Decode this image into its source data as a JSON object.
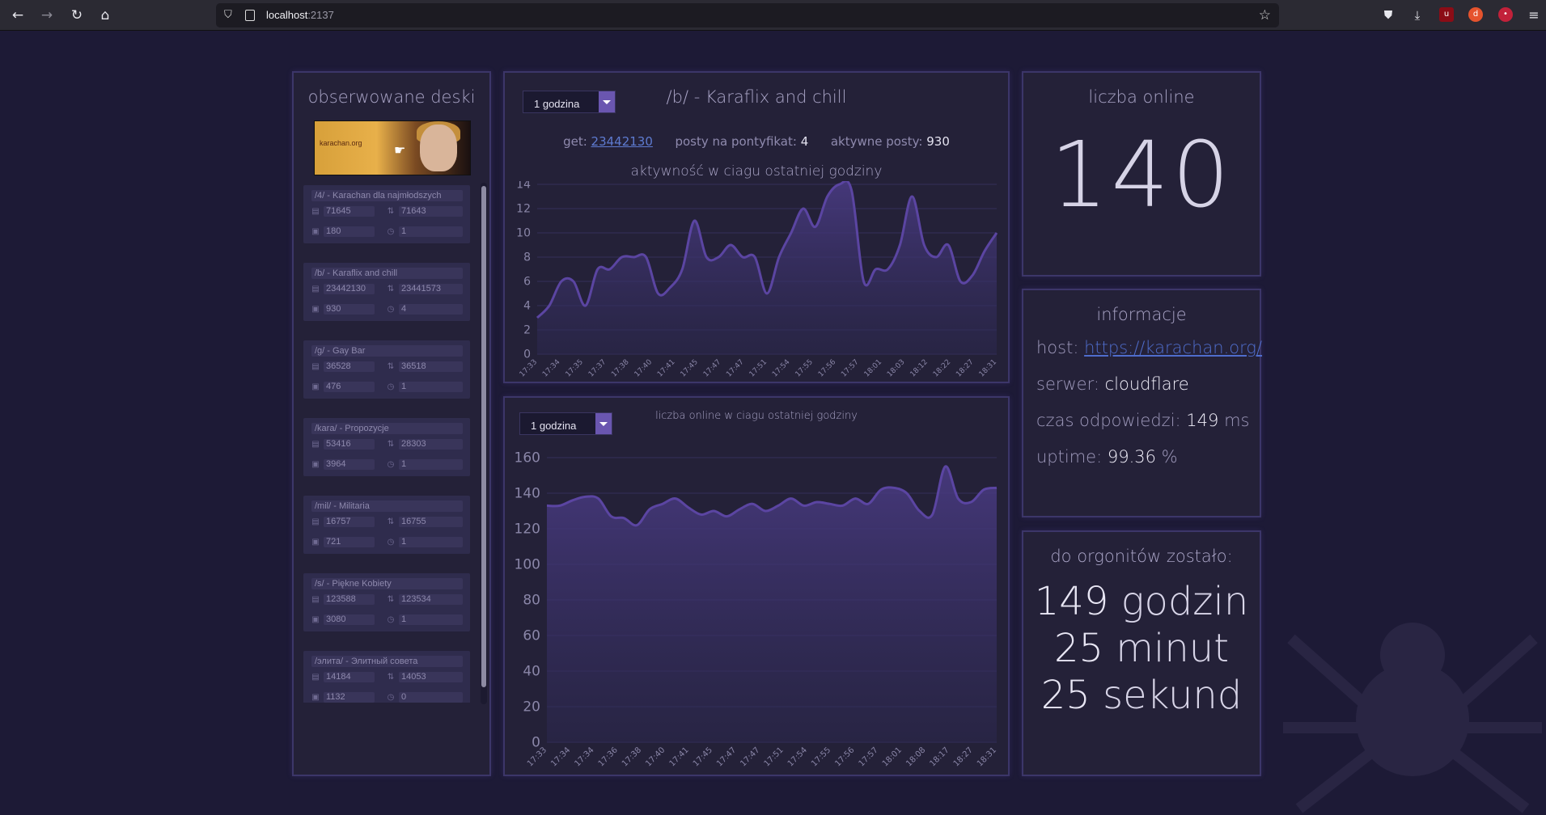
{
  "browser": {
    "url_host": "localhost",
    "url_port": ":2137"
  },
  "colors": {
    "background": "#1d1a36",
    "panel": "#242138",
    "panel_border": "#3c3669",
    "accent": "#6a56b0",
    "line": "#5b45a2",
    "link": "#5e7bd0"
  },
  "left_panel": {
    "title": "obserwowane deski",
    "banner_text": "karachan.org",
    "boards": [
      {
        "name": "/4/ - Karachan dla najmłodszych",
        "posts_total": "71645",
        "last_post": "71643",
        "active_posts": "180",
        "per_pontifikat": "1"
      },
      {
        "name": "/b/ - Karaflix and chill",
        "posts_total": "23442130",
        "last_post": "23441573",
        "active_posts": "930",
        "per_pontifikat": "4"
      },
      {
        "name": "/g/ - Gay Bar",
        "posts_total": "36528",
        "last_post": "36518",
        "active_posts": "476",
        "per_pontifikat": "1"
      },
      {
        "name": "/kara/ - Propozycje",
        "posts_total": "53416",
        "last_post": "28303",
        "active_posts": "3964",
        "per_pontifikat": "1"
      },
      {
        "name": "/mil/ - Militaria",
        "posts_total": "16757",
        "last_post": "16755",
        "active_posts": "721",
        "per_pontifikat": "1"
      },
      {
        "name": "/s/ - Piękne Kobiety",
        "posts_total": "123588",
        "last_post": "123534",
        "active_posts": "3080",
        "per_pontifikat": "1"
      },
      {
        "name": "/элита/ - Элитный совета",
        "posts_total": "14184",
        "last_post": "14053",
        "active_posts": "1132",
        "per_pontifikat": "0"
      }
    ]
  },
  "center_top": {
    "select_value": "1 godzina",
    "title": "/b/ - Karaflix and chill",
    "get_label": "get:",
    "get_value": "23442130",
    "posts_per_label": "posty na pontyfikat:",
    "posts_per_value": "4",
    "active_label": "aktywne posty:",
    "active_value": "930",
    "chart_title": "aktywność w ciagu ostatniej godziny"
  },
  "center_bottom": {
    "select_value": "1 godzina",
    "chart_title": "liczba online w ciagu ostatniej godziny"
  },
  "online_panel": {
    "title": "liczba online",
    "value": "140"
  },
  "info_panel": {
    "title": "informacje",
    "host_label": "host:",
    "host_value": "https://karachan.org/",
    "server_label": "serwer:",
    "server_value": "cloudflare",
    "response_label": "czas odpowiedzi:",
    "response_value": "149",
    "response_unit": "ms",
    "uptime_label": "uptime:",
    "uptime_value": "99.36",
    "uptime_unit": "%"
  },
  "countdown_panel": {
    "title": "do orgonitów zostało:",
    "hours": "149",
    "hours_unit": "godzin",
    "minutes": "25",
    "minutes_unit": "minut",
    "seconds": "25",
    "seconds_unit": "sekund"
  },
  "chart_data": [
    {
      "type": "area",
      "title": "aktywność w ciagu ostatniej godziny",
      "ylim": [
        0,
        14
      ],
      "yticks": [
        0,
        2,
        4,
        6,
        8,
        10,
        12,
        14
      ],
      "x_ticks": [
        "17:33",
        "17:34",
        "17:35",
        "17:37",
        "17:38",
        "17:40",
        "17:41",
        "17:45",
        "17:47",
        "17:47",
        "17:51",
        "17:54",
        "17:55",
        "17:56",
        "17:57",
        "18:01",
        "18:03",
        "18:12",
        "18:22",
        "18:27",
        "18:31"
      ],
      "values": [
        3,
        4,
        6,
        6,
        4,
        7,
        7,
        8,
        8,
        8,
        5,
        5.5,
        7,
        11,
        8,
        8,
        9,
        8,
        8,
        5,
        8,
        10,
        12,
        10.5,
        13,
        14,
        13.5,
        6,
        7,
        7,
        9,
        13,
        9,
        8,
        9,
        6,
        6.5,
        8.5,
        10
      ],
      "grid": true
    },
    {
      "type": "area",
      "title": "liczba online w ciagu ostatniej godziny",
      "ylim": [
        0,
        160
      ],
      "yticks": [
        0,
        20,
        40,
        60,
        80,
        100,
        120,
        140,
        160
      ],
      "x_ticks": [
        "17:33",
        "17:34",
        "17:34",
        "17:36",
        "17:38",
        "17:40",
        "17:41",
        "17:45",
        "17:47",
        "17:47",
        "17:51",
        "17:54",
        "17:55",
        "17:56",
        "17:57",
        "18:01",
        "18:08",
        "18:17",
        "18:27",
        "18:31"
      ],
      "values": [
        133,
        133,
        136,
        138,
        137,
        127,
        126,
        122,
        131,
        134,
        137,
        132,
        128,
        130,
        127,
        131,
        134,
        130,
        133,
        137,
        133,
        135,
        134,
        133,
        137,
        134,
        142,
        143,
        140,
        130,
        128,
        155,
        137,
        135,
        142,
        143
      ],
      "grid": true
    }
  ]
}
